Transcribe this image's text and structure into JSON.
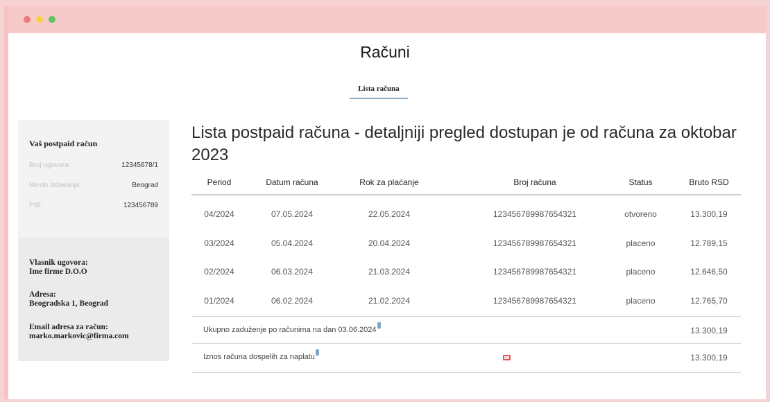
{
  "page": {
    "title": "Računi",
    "tab_label": "Lista računa"
  },
  "sidebar": {
    "heading": "Vaš postpaid račun",
    "fields": [
      {
        "label": "Broj ugovora:",
        "value": "12345678/1"
      },
      {
        "label": "Mesto izdavanja:",
        "value": "Beograd"
      },
      {
        "label": "PIB:",
        "value": "123456789"
      }
    ],
    "owner_label": "Vlasnik ugovora:",
    "owner_value": "Ime firme D.O.O",
    "address_label": "Adresa:",
    "address_value": "Beogradska 1, Beograd",
    "email_label": "Email adresa za račun:",
    "email_value": "marko.markovic@firma.com"
  },
  "main": {
    "heading": "Lista postpaid računa - detaljniji pregled dostupan je od računa za oktobar 2023",
    "columns": [
      "Period",
      "Datum računa",
      "Rok za plaćanje",
      "Broj računa",
      "Status",
      "Bruto RSD"
    ],
    "rows": [
      {
        "period": "04/2024",
        "datum": "07.05.2024",
        "rok": "22.05.2024",
        "broj": "123456789987654321",
        "status": "otvoreno",
        "bruto": "13.300,19"
      },
      {
        "period": "03/2024",
        "datum": "05.04.2024",
        "rok": "20.04.2024",
        "broj": "123456789987654321",
        "status": "placeno",
        "bruto": "12.789,15"
      },
      {
        "period": "02/2024",
        "datum": "06.03.2024",
        "rok": "21.03.2024",
        "broj": "123456789987654321",
        "status": "placeno",
        "bruto": "12.646,50"
      },
      {
        "period": "01/2024",
        "datum": "06.02.2024",
        "rok": "21.02.2024",
        "broj": "123456789987654321",
        "status": "placeno",
        "bruto": "12.765,70"
      }
    ],
    "total_label": "Ukupno zaduženje po računima na dan 03.06.2024",
    "total_value": "13.300,19",
    "due_label": "Iznos računa dospelih za naplatu",
    "due_value": "13.300,19"
  },
  "icons": {
    "info": "info-note-icon",
    "payment": "payment-card-icon"
  },
  "colors": {
    "window_bar": "#f7caca",
    "tab_underline": "#8aa6c0",
    "payment_icon": "#e25555"
  }
}
